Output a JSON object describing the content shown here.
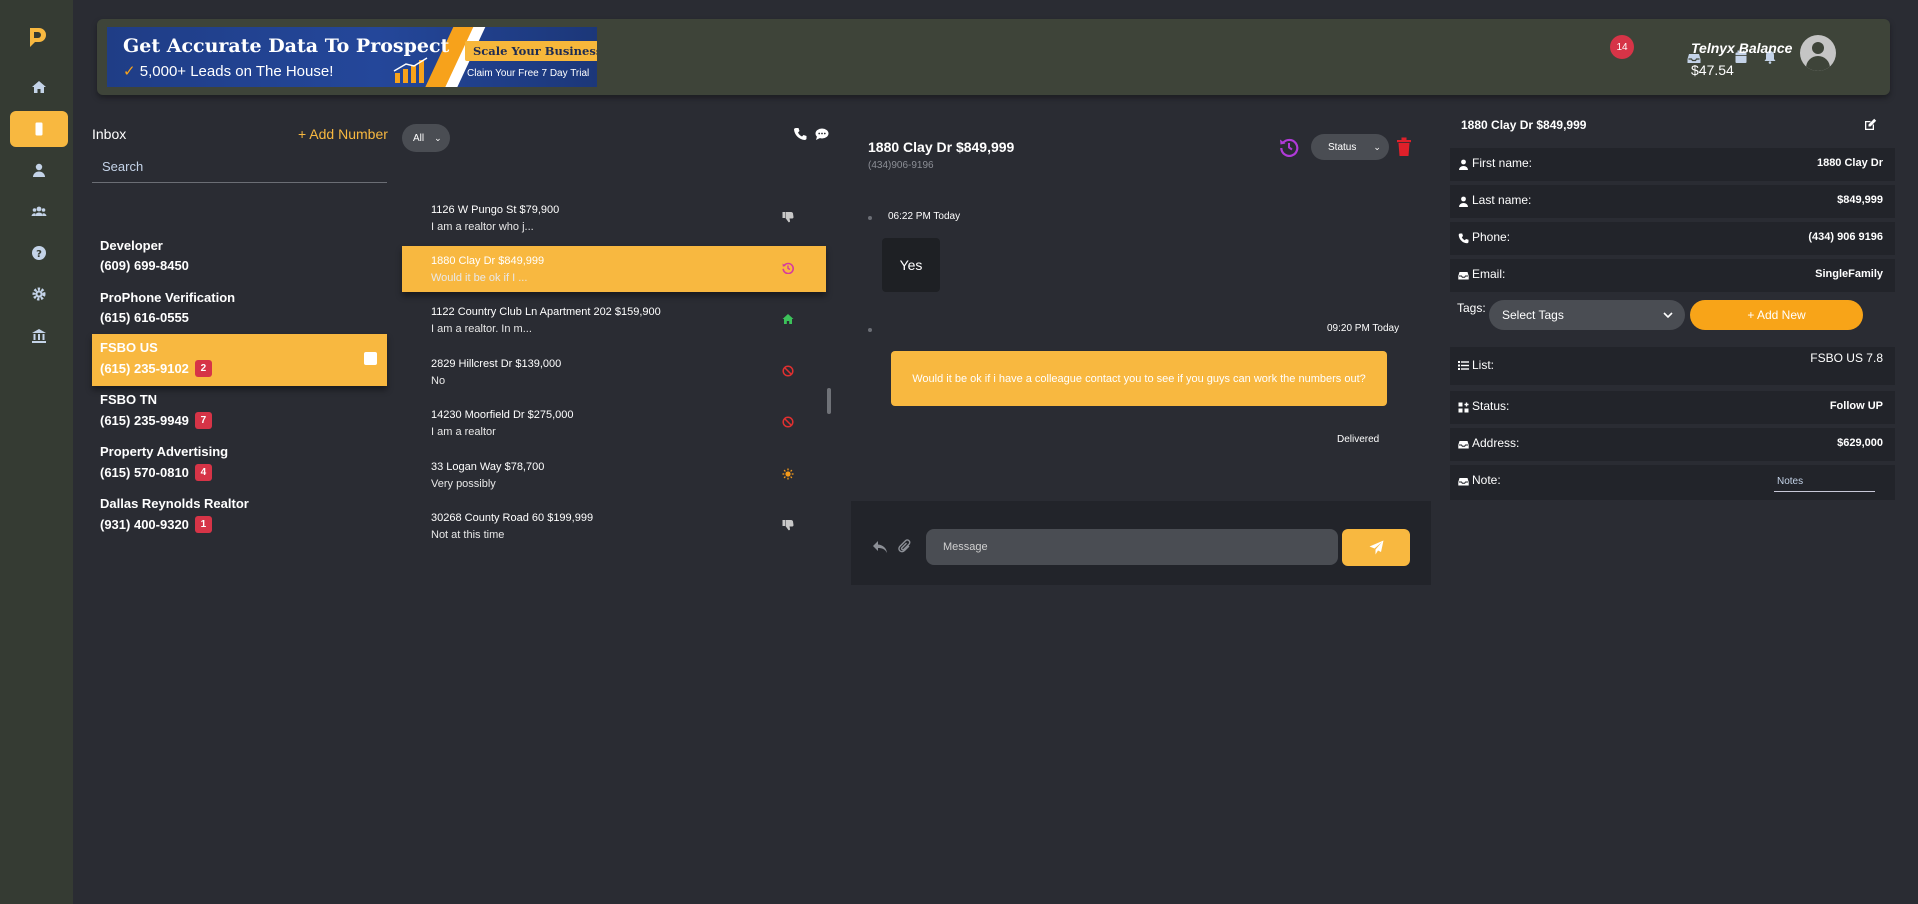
{
  "colors": {
    "accent": "#f8b840",
    "badge": "#d63447",
    "sidebar": "#353b33",
    "topbar": "#3e4439",
    "bg": "#2a2c33"
  },
  "sidebar": {
    "items": [
      {
        "icon": "home-icon"
      },
      {
        "icon": "mobile-icon",
        "active": true
      },
      {
        "icon": "user-icon"
      },
      {
        "icon": "users-icon"
      },
      {
        "icon": "help-icon"
      },
      {
        "icon": "gear-icon"
      },
      {
        "icon": "bank-icon"
      }
    ]
  },
  "banner": {
    "headline": "Get Accurate Data To Prospect",
    "check": "✓",
    "subline": "5,000+ Leads on The House!",
    "cta": "Scale Your Business",
    "trial": "Claim Your Free 7 Day Trial"
  },
  "header": {
    "notification_count": "14",
    "telnyx_label": "Telnyx Balance",
    "telnyx_amount": "$47.54"
  },
  "inbox": {
    "title": "Inbox",
    "add_number": "+ Add Number",
    "search_placeholder": "Search",
    "numbers": [
      {
        "name": "Developer",
        "phone": "(609) 699-8450",
        "badge": ""
      },
      {
        "name": "ProPhone Verification",
        "phone": "(615) 616-0555",
        "badge": ""
      },
      {
        "name": "FSBO US",
        "phone": "(615) 235-9102",
        "badge": "2",
        "active": true
      },
      {
        "name": "FSBO TN",
        "phone": "(615) 235-9949",
        "badge": "7"
      },
      {
        "name": "Property Advertising",
        "phone": "(615) 570-0810",
        "badge": "4"
      },
      {
        "name": "Dallas Reynolds Realtor",
        "phone": "(931) 400-9320",
        "badge": "1"
      }
    ]
  },
  "conversations": {
    "filter_label": "All",
    "filter_caret": "⌄",
    "items": [
      {
        "title": "1126 W Pungo St $79,900",
        "preview": "I am a realtor who j...",
        "icon": "thumbs-down-icon",
        "icon_color": "#c8c8c8"
      },
      {
        "title": "1880 Clay Dr $849,999",
        "preview": "Would it be ok if I ...",
        "icon": "history-icon",
        "icon_color": "#d63aa0",
        "active": true
      },
      {
        "title": "1122 Country Club Ln Apartment 202 $159,900",
        "preview": "I am a realtor. In m...",
        "icon": "home-icon",
        "icon_color": "#3cc25a"
      },
      {
        "title": "2829 Hillcrest Dr $139,000",
        "preview": "No",
        "icon": "ban-icon",
        "icon_color": "#e03030"
      },
      {
        "title": "14230 Moorfield Dr $275,000",
        "preview": "I am a realtor",
        "icon": "ban-icon",
        "icon_color": "#e03030"
      },
      {
        "title": "33 Logan Way $78,700",
        "preview": "Very possibly",
        "icon": "sun-icon",
        "icon_color": "#f59a1a"
      },
      {
        "title": "30268 County Road 60 $199,999",
        "preview": "Not at this time",
        "icon": "thumbs-down-icon",
        "icon_color": "#c8c8c8"
      }
    ]
  },
  "chat": {
    "title": "1880 Clay Dr $849,999",
    "phone": "(434)906-9196",
    "status_label": "Status",
    "status_caret": "⌄",
    "messages": [
      {
        "direction": "in",
        "time": "06:22 PM Today",
        "text": "Yes"
      },
      {
        "direction": "out",
        "time": "09:20 PM Today",
        "text": "Would it be ok if i have a colleague contact you to see if you guys can work the numbers out?"
      }
    ],
    "delivered": "Delivered",
    "message_placeholder": "Message"
  },
  "details": {
    "title": "1880 Clay Dr $849,999",
    "first_name_label": "First name:",
    "first_name": "1880 Clay Dr",
    "last_name_label": "Last name:",
    "last_name": "$849,999",
    "phone_label": "Phone:",
    "phone": "(434) 906 9196",
    "email_label": "Email:",
    "email": "SingleFamily",
    "tags_label": "Tags:",
    "tags_placeholder": "Select Tags",
    "add_new": "+ Add New",
    "list_label": "List:",
    "list": "FSBO US 7.8",
    "status_label": "Status:",
    "status": "Follow UP",
    "address_label": "Address:",
    "address": "$629,000",
    "note_label": "Note:",
    "notes_placeholder": "Notes"
  }
}
